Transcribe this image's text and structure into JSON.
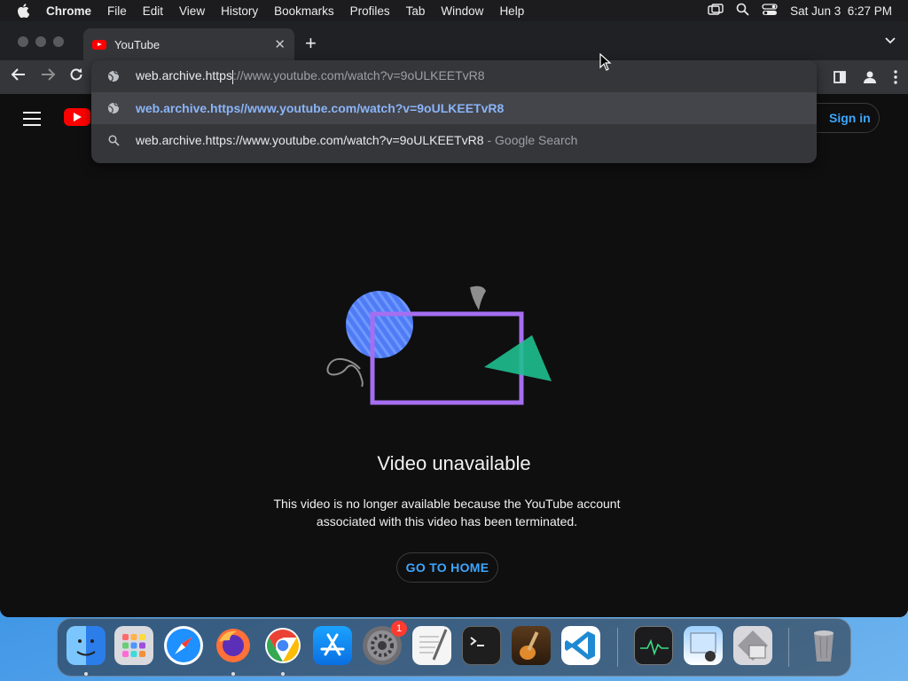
{
  "menubar": {
    "app_name": "Chrome",
    "items": [
      "File",
      "Edit",
      "View",
      "History",
      "Bookmarks",
      "Profiles",
      "Tab",
      "Window",
      "Help"
    ],
    "datetime": "Sat Jun 3  6:27 PM"
  },
  "browser": {
    "tab_title": "YouTube",
    "omnibox": {
      "typed_prefix": "web.archive.https",
      "typed_suffix": "://www.youtube.com/watch?v=9oULKEETvR8",
      "suggestion_url": "web.archive.https//www.youtube.com/watch?v=9oULKEETvR8",
      "search_query": "web.archive.https://www.youtube.com/watch?v=9oULKEETvR8",
      "search_suffix": " - Google Search"
    }
  },
  "youtube": {
    "signin_label": "Sign in",
    "error_title": "Video unavailable",
    "error_line1": "This video is no longer available because the YouTube account",
    "error_line2": "associated with this video has been terminated.",
    "home_button": "GO TO HOME"
  },
  "dock": {
    "items": [
      "finder-icon",
      "launchpad-icon",
      "safari-icon",
      "firefox-icon",
      "chrome-icon",
      "app-store-icon",
      "system-settings-icon",
      "textedit-icon",
      "terminal-icon",
      "garageband-icon",
      "vscode-icon",
      "activity-monitor-icon",
      "preview-icon",
      "utility-icon",
      "trash-icon"
    ],
    "settings_badge": "1"
  },
  "colors": {
    "accent_blue": "#3ea6ff",
    "youtube_red": "#ff0000",
    "page_bg": "#0f0f0f"
  }
}
